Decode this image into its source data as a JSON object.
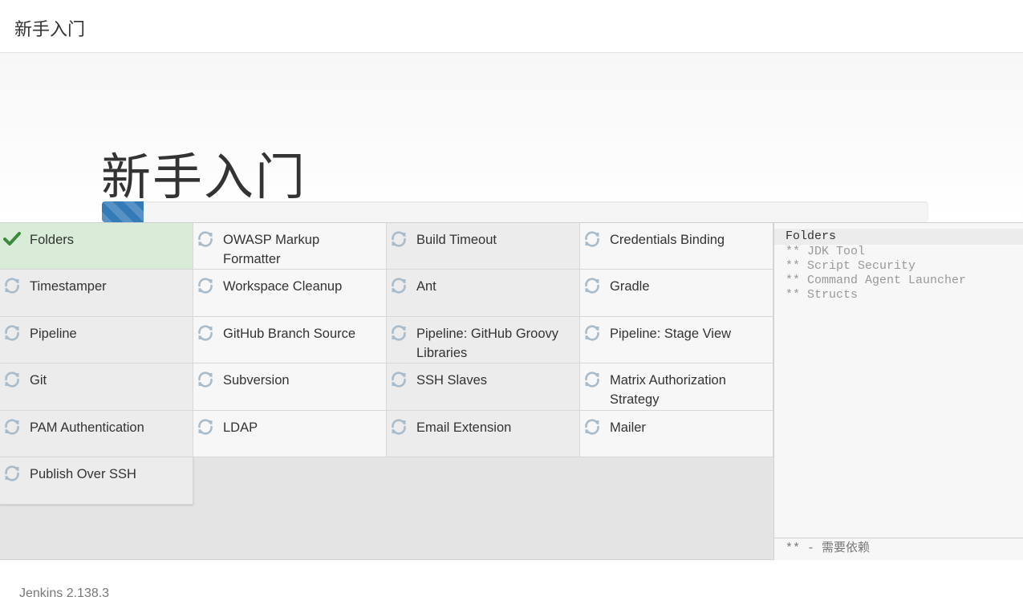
{
  "header": {
    "title": "新手入门"
  },
  "main": {
    "title": "新手入门",
    "progress": 0.05,
    "progress_color": "#337ab7"
  },
  "plugins": [
    {
      "label": "Folders",
      "status": "success",
      "icon": "check-icon"
    },
    {
      "label": "OWASP Markup Formatter",
      "status": "pending",
      "icon": "refresh-icon"
    },
    {
      "label": "Build Timeout",
      "status": "pending",
      "icon": "refresh-icon"
    },
    {
      "label": "Credentials Binding",
      "status": "pending",
      "icon": "refresh-icon"
    },
    {
      "label": "Timestamper",
      "status": "pending",
      "icon": "refresh-icon"
    },
    {
      "label": "Workspace Cleanup",
      "status": "pending",
      "icon": "refresh-icon"
    },
    {
      "label": "Ant",
      "status": "pending",
      "icon": "refresh-icon"
    },
    {
      "label": "Gradle",
      "status": "pending",
      "icon": "refresh-icon"
    },
    {
      "label": "Pipeline",
      "status": "pending",
      "icon": "refresh-icon"
    },
    {
      "label": "GitHub Branch Source",
      "status": "pending",
      "icon": "refresh-icon"
    },
    {
      "label": "Pipeline: GitHub Groovy Libraries",
      "status": "pending",
      "icon": "refresh-icon"
    },
    {
      "label": "Pipeline: Stage View",
      "status": "pending",
      "icon": "refresh-icon"
    },
    {
      "label": "Git",
      "status": "pending",
      "icon": "refresh-icon"
    },
    {
      "label": "Subversion",
      "status": "pending",
      "icon": "refresh-icon"
    },
    {
      "label": "SSH Slaves",
      "status": "pending",
      "icon": "refresh-icon"
    },
    {
      "label": "Matrix Authorization Strategy",
      "status": "pending",
      "icon": "refresh-icon"
    },
    {
      "label": "PAM Authentication",
      "status": "pending",
      "icon": "refresh-icon"
    },
    {
      "label": "LDAP",
      "status": "pending",
      "icon": "refresh-icon"
    },
    {
      "label": "Email Extension",
      "status": "pending",
      "icon": "refresh-icon"
    },
    {
      "label": "Mailer",
      "status": "pending",
      "icon": "refresh-icon"
    },
    {
      "label": "Publish Over SSH",
      "status": "pending",
      "icon": "refresh-icon"
    }
  ],
  "log": {
    "current": "Folders",
    "dependencies": [
      "** JDK Tool",
      "** Script Security",
      "** Command Agent Launcher",
      "** Structs"
    ],
    "legend": "** - 需要依赖"
  },
  "footer": {
    "version": "Jenkins 2.138.3"
  },
  "colors": {
    "success_bg": "#d8ecd7",
    "check": "#3c8a3c",
    "pending_icon": "#a9bccb"
  }
}
